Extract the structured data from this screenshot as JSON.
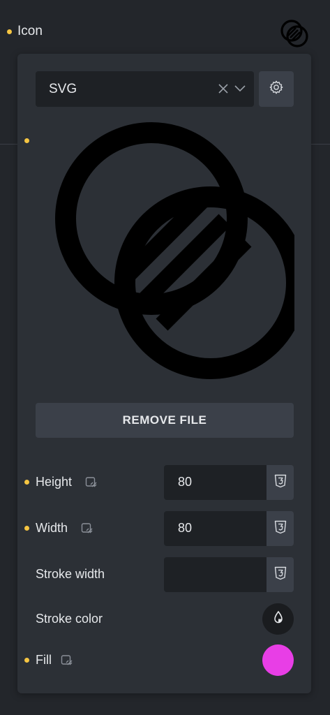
{
  "header": {
    "label": "Icon",
    "icon": "intersecting-circles-icon"
  },
  "select": {
    "value": "SVG",
    "clear_icon": "close-icon",
    "chevron_icon": "chevron-down-icon",
    "settings_icon": "gear-icon"
  },
  "preview": {
    "icon": "intersecting-circles-striped-icon"
  },
  "remove_button": {
    "label": "REMOVE FILE"
  },
  "controls": {
    "height": {
      "label": "Height",
      "value": "80",
      "unit_icon": "css3-icon",
      "link_icon": "responsive-link-icon"
    },
    "width": {
      "label": "Width",
      "value": "80",
      "unit_icon": "css3-icon",
      "link_icon": "responsive-link-icon"
    },
    "stroke_width": {
      "label": "Stroke width",
      "value": "",
      "unit_icon": "css3-icon"
    },
    "stroke_color": {
      "label": "Stroke color",
      "icon": "droplet-icon"
    },
    "fill": {
      "label": "Fill",
      "color": "#e83ee6",
      "link_icon": "responsive-link-icon"
    }
  },
  "colors": {
    "accent_dot": "#f5c542",
    "fill_swatch": "#e83ee6",
    "panel_bg": "#2c3036",
    "page_bg": "#23262b"
  }
}
